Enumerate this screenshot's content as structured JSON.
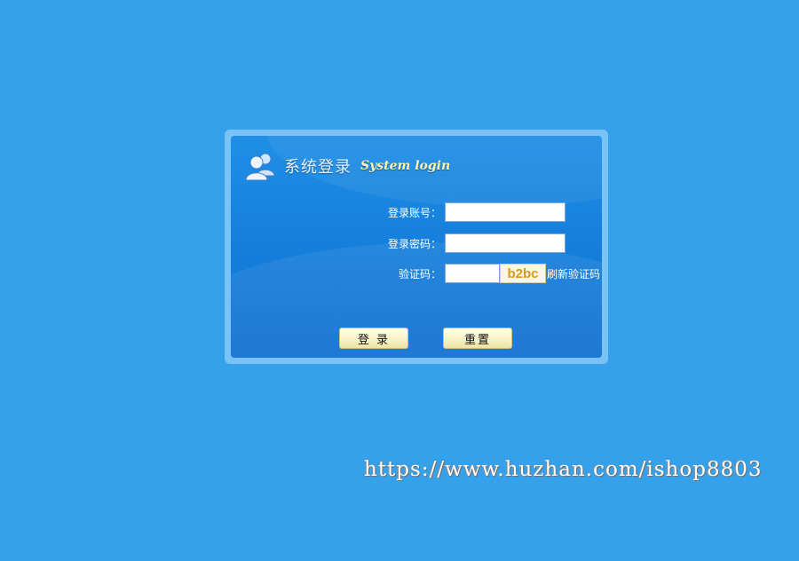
{
  "header": {
    "icon": "users-icon",
    "title_cn": "系统登录",
    "title_en": "System login"
  },
  "form": {
    "account_label": "登录账号：",
    "account_value": "",
    "password_label": "登录密码：",
    "password_value": "",
    "captcha_label": "验证码：",
    "captcha_value": "",
    "captcha_image_text": "b2bc",
    "refresh_label": "刷新验证码"
  },
  "buttons": {
    "login_label": "登 录",
    "reset_label": "重置"
  },
  "watermark": "https://www.huzhan.com/ishop8803",
  "colors": {
    "background": "#35a1ea",
    "panel": "#1680dc",
    "frame": "#79c3f6",
    "title_en": "#fff6b0",
    "button": "#f8f3c8",
    "captcha_text": "#d69a1e"
  }
}
